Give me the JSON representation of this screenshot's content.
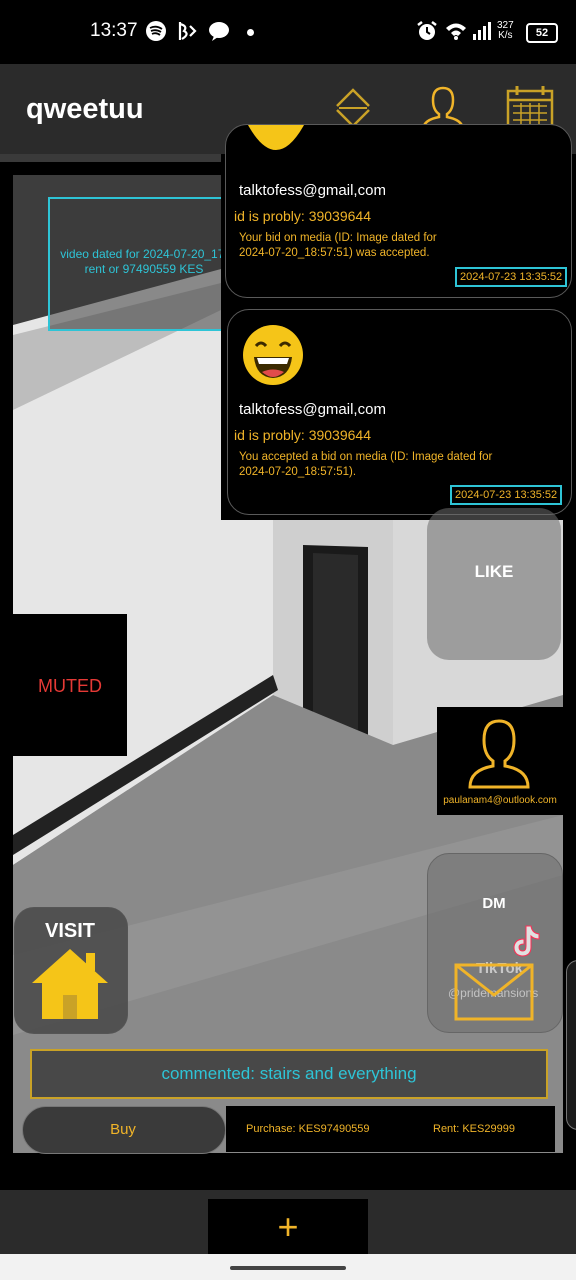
{
  "status_bar": {
    "time": "13:37",
    "net_speed_value": "327",
    "net_speed_unit": "K/s",
    "battery": "52",
    "icons": [
      "spotify-icon",
      "bolt-icon",
      "chat-icon",
      "dot-icon",
      "alarm-icon",
      "wifi-icon",
      "signal-icon",
      "battery-icon"
    ]
  },
  "app_bar": {
    "title": "qweetuu",
    "icons": [
      "sort-icon",
      "profile-icon",
      "calendar-icon"
    ]
  },
  "video": {
    "overlay_text_line1": "video dated for 2024-07-20_17:",
    "overlay_text_line2": "rent or 97490559 KES"
  },
  "notifications": [
    {
      "email": "talktofess@gmail,com",
      "id_text": "id is probly: 39039644",
      "message_line1": "Your bid on media (ID: Image dated for",
      "message_line2": "2024-07-20_18:57:51) was accepted.",
      "timestamp": "2024-07-23 13:35:52"
    },
    {
      "email": "talktofess@gmail,com",
      "id_text": "id is probly: 39039644",
      "message_line1": "You accepted a bid on media (ID: Image dated for",
      "message_line2": "2024-07-20_18:57:51).",
      "timestamp": "2024-07-23 13:35:52"
    }
  ],
  "actions": {
    "muted": "MUTED",
    "like": "LIKE",
    "profile_email": "paulanam4@outlook.com",
    "dm": "DM",
    "visit": "VISIT",
    "watermark_brand": "TikTok",
    "watermark_user": "@pridemansions"
  },
  "comment": "commented: stairs and everything",
  "purchase": {
    "buy_label": "Buy",
    "purchase_price": "Purchase: KES97490559",
    "rent_price": "Rent: KES29999"
  },
  "bottom": {
    "add_label": "+"
  },
  "colors": {
    "accent": "#f0b429",
    "cyan": "#2ec4d6",
    "muted_red": "#e53935"
  }
}
